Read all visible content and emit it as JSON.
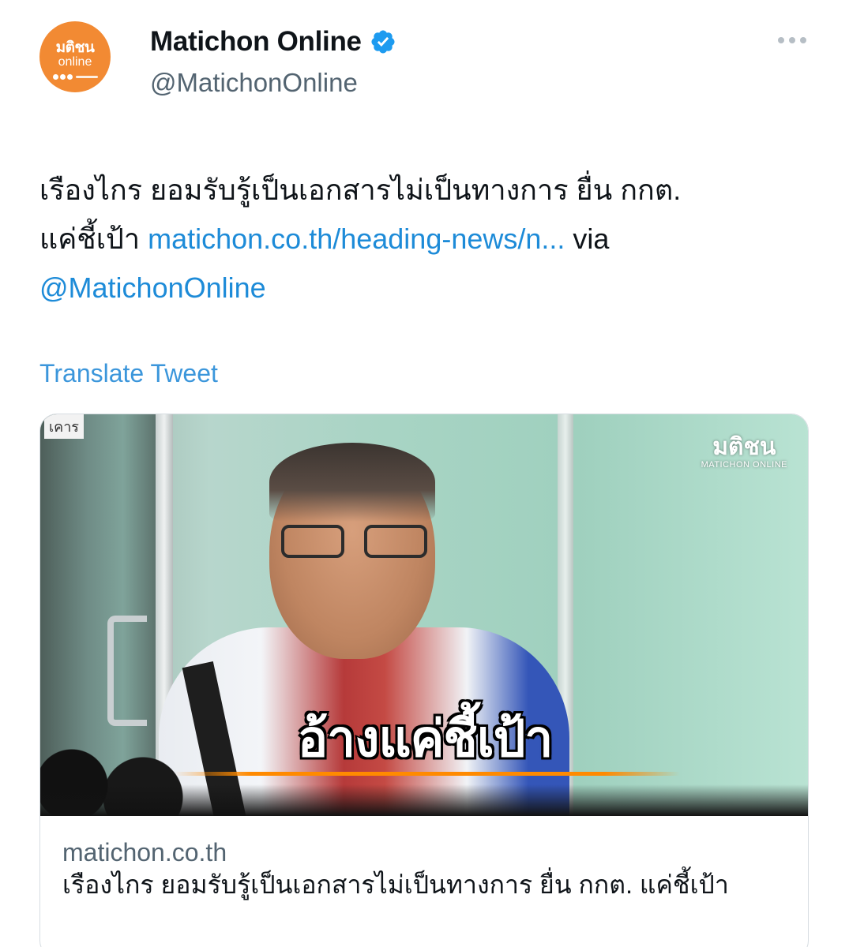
{
  "author": {
    "display_name": "Matichon Online",
    "handle": "@MatichonOnline",
    "avatar_logo": "มติชน",
    "avatar_sub": "online",
    "verified_color": "#1d9bf0",
    "avatar_color": "#f28a33"
  },
  "tweet": {
    "text_part1": "เรืองไกร ยอมรับรู้เป็นเอกสารไม่เป็นทางการ ยื่น กกต.",
    "text_part2": "แค่ชี้เป้า ",
    "link": "matichon.co.th/heading-news/n...",
    "text_part3": " via",
    "mention": "@MatichonOnline",
    "translate_label": "Translate Tweet",
    "link_color": "#1d8bd8"
  },
  "card": {
    "image_overlay_text": "อ้างแค่ชี้เป้า",
    "corner_text": "เคาร",
    "watermark_logo": "มติชน",
    "watermark_sub": "MATICHON ONLINE",
    "domain": "matichon.co.th",
    "title": "เรืองไกร ยอมรับรู้เป็นเอกสารไม่เป็นทางการ ยื่น กกต. แค่ชี้เป้า"
  },
  "icons": {
    "verified": "verified-badge-icon",
    "more": "more-options-icon"
  }
}
